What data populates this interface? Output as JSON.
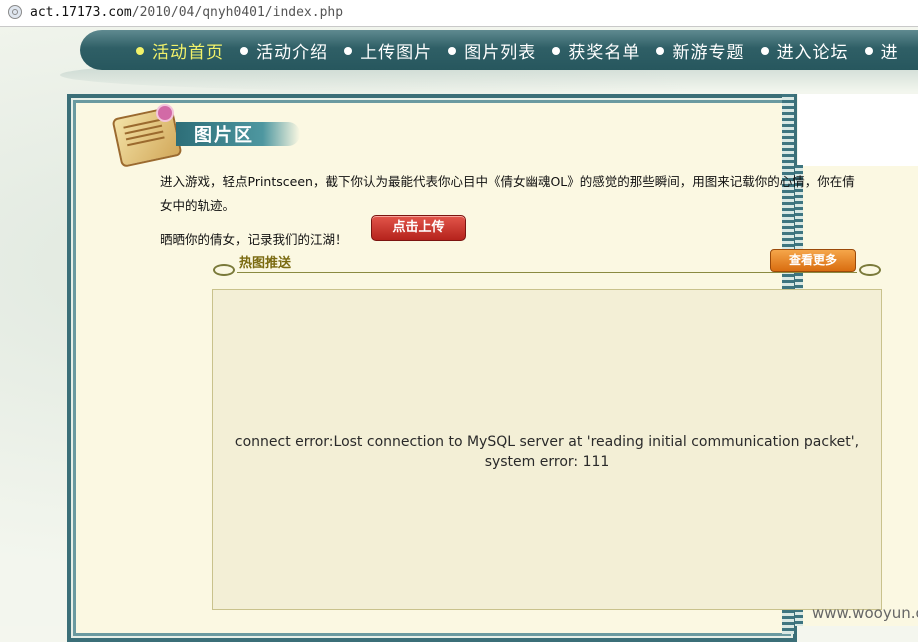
{
  "browser": {
    "url_host": "act.17173.com",
    "url_path": "/2010/04/qnyh0401/index.php"
  },
  "nav": {
    "items": [
      {
        "label": "活动首页",
        "active": true
      },
      {
        "label": "活动介绍"
      },
      {
        "label": "上传图片"
      },
      {
        "label": "图片列表"
      },
      {
        "label": "获奖名单"
      },
      {
        "label": "新游专题"
      },
      {
        "label": "进入论坛"
      },
      {
        "label": "进"
      }
    ]
  },
  "section": {
    "title": "图片区"
  },
  "intro": {
    "line1": "进入游戏，轻点Printsceen，截下你认为最能代表你心目中《倩女幽魂OL》的感觉的那些瞬间，用图来记载你的心情，你在倩",
    "line2": "女中的轨迹。",
    "line3": "晒晒你的倩女，记录我们的江湖！"
  },
  "buttons": {
    "upload": "点击上传",
    "more": "查看更多"
  },
  "hot": {
    "label": "热图推送"
  },
  "error": {
    "line1": "connect error:Lost connection to MySQL server at 'reading initial communication packet',",
    "line2": "system error: 111"
  },
  "watermark": "www.wooyun.org",
  "colors": {
    "nav_bg": "#2f5f66",
    "nav_active": "#f2f26a",
    "upload_button": "#b5231c",
    "more_button": "#d96d10"
  }
}
